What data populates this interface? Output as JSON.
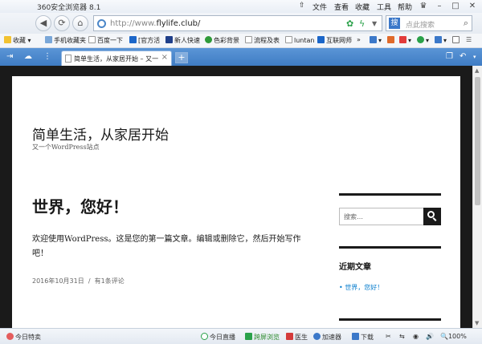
{
  "window": {
    "app_title": "360安全浏览器 8.1",
    "menu": [
      "文件",
      "查看",
      "收藏",
      "工具",
      "帮助"
    ]
  },
  "address": {
    "url_prefix": "http://www.",
    "url_domain": "flylife.club/"
  },
  "search": {
    "placeholder": "点此搜索"
  },
  "bookmarks": {
    "favorites": "收藏",
    "items": [
      "手机收藏夹",
      "百度一下",
      "[官方活",
      "新人快速",
      "色彩背景",
      "流程及表",
      "luntan",
      "互联网师"
    ]
  },
  "tab": {
    "title": "简单生活，从家居开始 – 又一"
  },
  "site": {
    "title": "简单生活，从家居开始",
    "description": "又一个WordPress站点"
  },
  "post": {
    "title": "世界，您好！",
    "body": "欢迎使用WordPress。这是您的第一篇文章。编辑或删除它，然后开始写作吧！",
    "date": "2016年10月31日",
    "sep": "/",
    "comments": "有1条评论"
  },
  "sidebar": {
    "search_placeholder": "搜索…",
    "recent_title": "近期文章",
    "recent_items": [
      "世界，您好！"
    ]
  },
  "status": {
    "left": "今日特卖",
    "live": "今日直播",
    "cross": "跨屏浏览",
    "doctor": "医生",
    "accelerator": "加速器",
    "download": "下载",
    "zoom": "100%"
  }
}
